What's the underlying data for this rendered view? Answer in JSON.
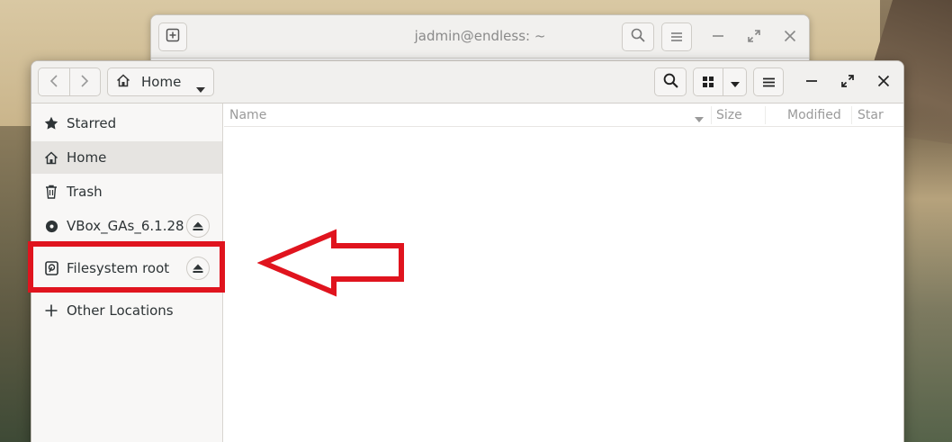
{
  "desktop": {
    "background": "mountain-landscape"
  },
  "terminal": {
    "title": "jadmin@endless: ~",
    "icons": [
      "new-tab-icon",
      "search-icon",
      "menu-icon",
      "minimize-icon",
      "maximize-icon",
      "close-icon"
    ]
  },
  "files": {
    "header": {
      "location_label": "Home",
      "icons": [
        "back-arrow-icon",
        "forward-arrow-icon",
        "home-icon",
        "dropdown-caret-icon",
        "search-icon",
        "grid-view-icon",
        "menu-icon",
        "minimize-icon",
        "maximize-icon",
        "close-icon"
      ]
    },
    "sidebar": {
      "items": [
        {
          "label": "Starred",
          "icon": "star-icon"
        },
        {
          "label": "Home",
          "icon": "home-icon",
          "active": true
        },
        {
          "label": "Trash",
          "icon": "trash-icon"
        },
        {
          "label": "VBox_GAs_6.1.28",
          "icon": "disc-icon",
          "ejectable": true
        },
        {
          "label": "Filesystem root",
          "icon": "drive-icon",
          "ejectable": true
        },
        {
          "label": "Other Locations",
          "icon": "plus-icon"
        }
      ]
    },
    "columns": {
      "name": "Name",
      "size": "Size",
      "modified": "Modified",
      "star": "Star"
    }
  },
  "annotation": {
    "highlight_color": "#e0141e",
    "target": "Filesystem root"
  }
}
